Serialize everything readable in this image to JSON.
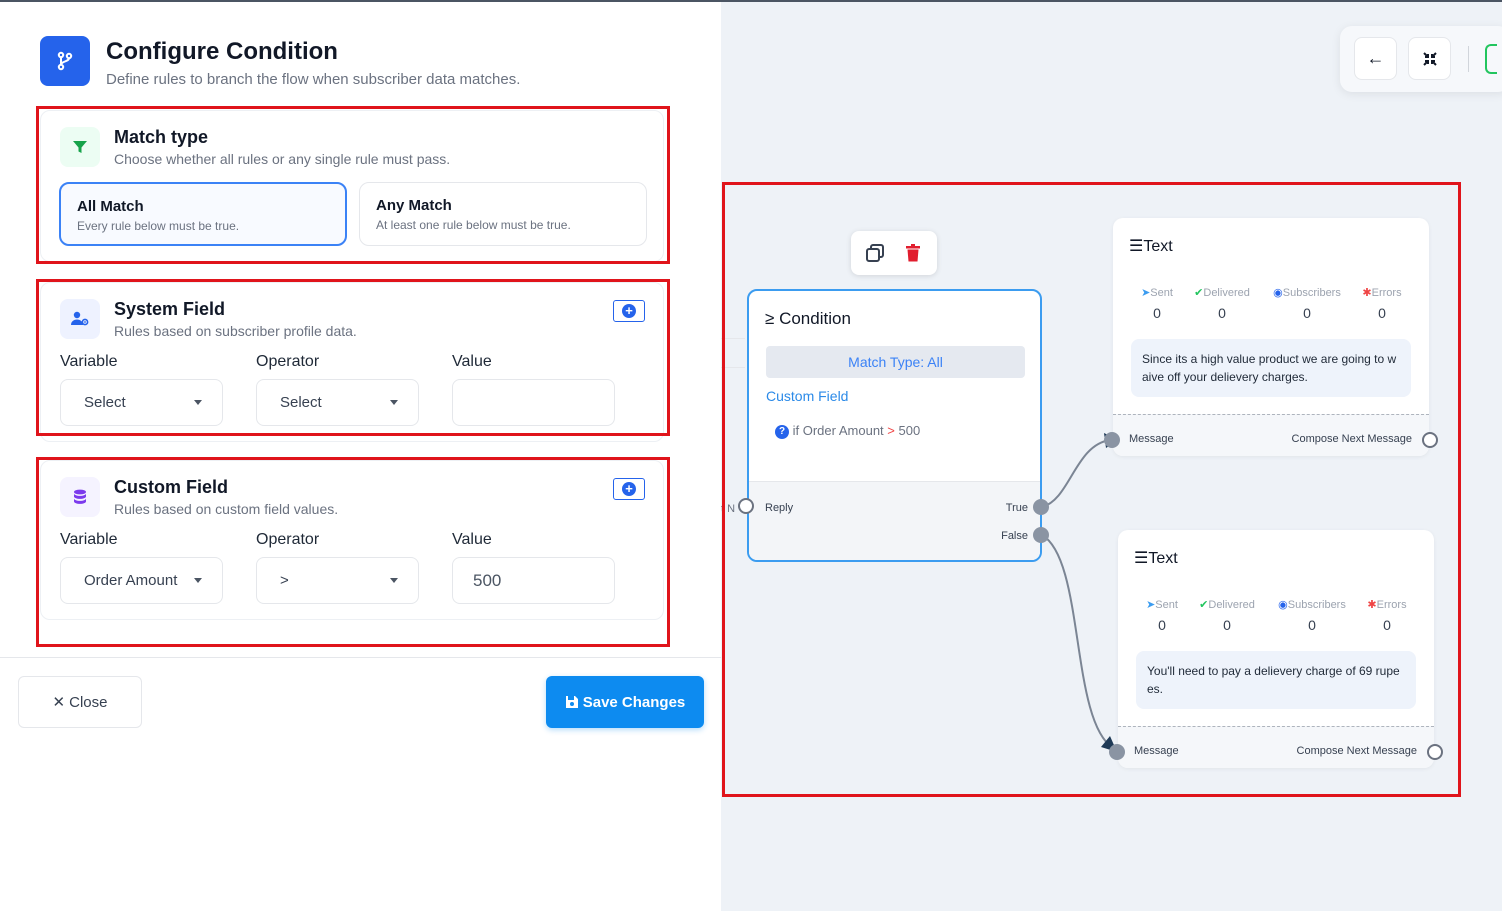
{
  "panel": {
    "title": "Configure Condition",
    "subtitle": "Define rules to branch the flow when subscriber data matches."
  },
  "match_type": {
    "title": "Match type",
    "subtitle": "Choose whether all rules or any single rule must pass.",
    "options": [
      {
        "label": "All Match",
        "desc": "Every rule below must be true.",
        "selected": true
      },
      {
        "label": "Any Match",
        "desc": "At least one rule below must be true.",
        "selected": false
      }
    ]
  },
  "system_field": {
    "title": "System Field",
    "subtitle": "Rules based on subscriber profile data.",
    "variable_label": "Variable",
    "operator_label": "Operator",
    "value_label": "Value",
    "variable_value": "Select",
    "operator_value": "Select",
    "value": ""
  },
  "custom_field": {
    "title": "Custom Field",
    "subtitle": "Rules based on custom field values.",
    "variable_label": "Variable",
    "operator_label": "Operator",
    "value_label": "Value",
    "variable_value": "Order Amount",
    "operator_value": ">",
    "value": "500"
  },
  "footer": {
    "close_label": "Close",
    "save_label": "Save Changes"
  },
  "toolbar": {
    "back_icon": "←",
    "collapse_icon": "⤡"
  },
  "condition_node": {
    "title": "Condition",
    "match_pill": "Match Type: All",
    "section_label": "Custom Field",
    "rule_prefix": "if Order Amount",
    "rule_operator": ">",
    "rule_value": "500",
    "reply_label": "Reply",
    "true_label": "True",
    "false_label": "False",
    "ghost_text": "t N"
  },
  "text_nodes": [
    {
      "title": "Text",
      "stats": [
        {
          "label": "Sent",
          "value": "0"
        },
        {
          "label": "Delivered",
          "value": "0"
        },
        {
          "label": "Subscribers",
          "value": "0"
        },
        {
          "label": "Errors",
          "value": "0"
        }
      ],
      "message": "Since its a high value product we are going to waive off your delievery charges.",
      "in_label": "Message",
      "out_label": "Compose Next Message"
    },
    {
      "title": "Text",
      "stats": [
        {
          "label": "Sent",
          "value": "0"
        },
        {
          "label": "Delivered",
          "value": "0"
        },
        {
          "label": "Subscribers",
          "value": "0"
        },
        {
          "label": "Errors",
          "value": "0"
        }
      ],
      "message": "You'll need to pay a delievery charge of 69 rupees.",
      "in_label": "Message",
      "out_label": "Compose Next Message"
    }
  ],
  "colors": {
    "accent": "#2563eb",
    "save": "#0d8bf0",
    "highlight": "#e0141b",
    "sent": "#3b9cf0",
    "delivered": "#22c55e",
    "subscribers": "#2563eb",
    "errors": "#ef4444"
  }
}
